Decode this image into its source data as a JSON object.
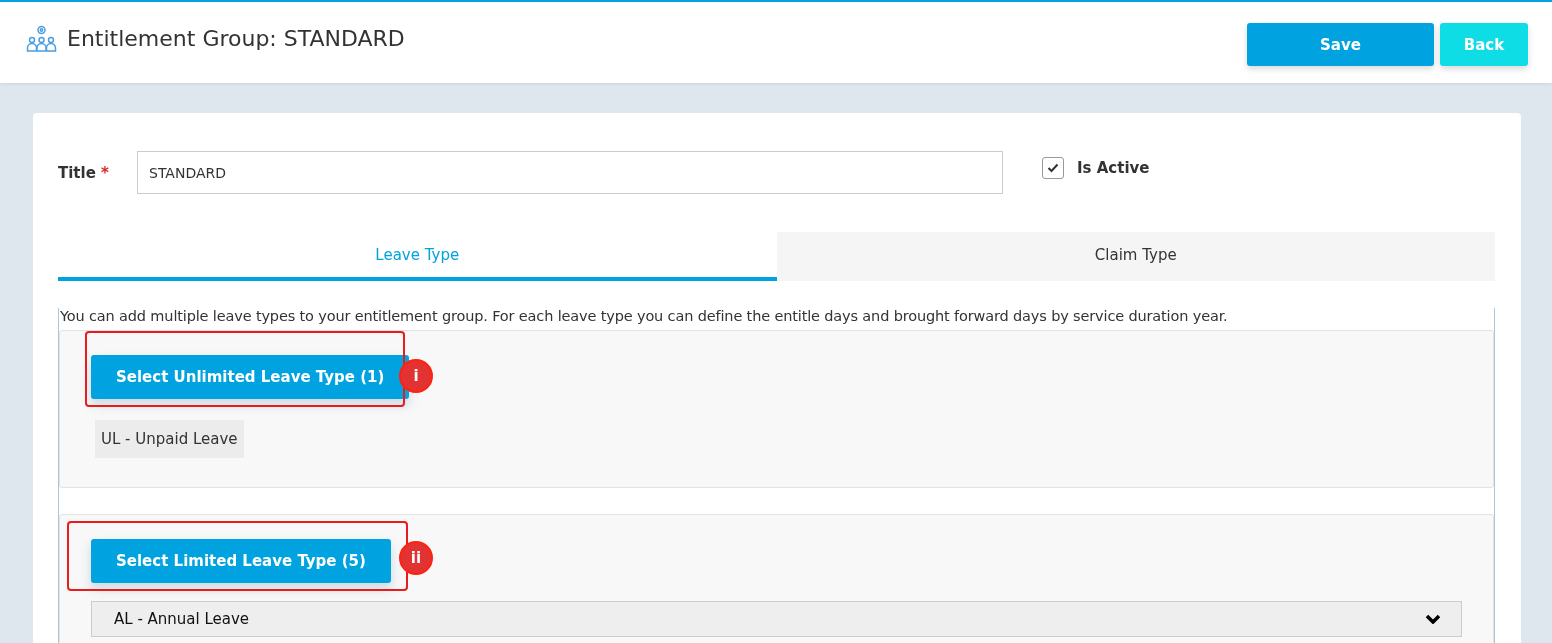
{
  "header": {
    "title": "Entitlement Group: STANDARD",
    "buttons": [
      {
        "label": "Save",
        "kind": "primary"
      },
      {
        "label": "Back",
        "kind": "secondary"
      }
    ]
  },
  "form": {
    "title_label": "Title",
    "required_mark": "*",
    "title_value": "STANDARD",
    "is_active": {
      "label": "Is Active",
      "checked": true
    }
  },
  "tabs": [
    {
      "label": "Leave Type",
      "selected": true
    },
    {
      "label": "Claim Type",
      "selected": false
    }
  ],
  "description": "You can add multiple leave types to your entitlement group. For each leave type you can define the entitle days and brought forward days by service duration year.",
  "sections": [
    {
      "button": "Select Unlimited Leave Type (1)",
      "marker": "i",
      "tags": [
        "UL - Unpaid Leave"
      ]
    },
    {
      "button": "Select Limited Leave Type (5)",
      "marker": "ii",
      "accordion": [
        {
          "label": "AL - Annual Leave",
          "expanded": false
        }
      ]
    }
  ]
}
